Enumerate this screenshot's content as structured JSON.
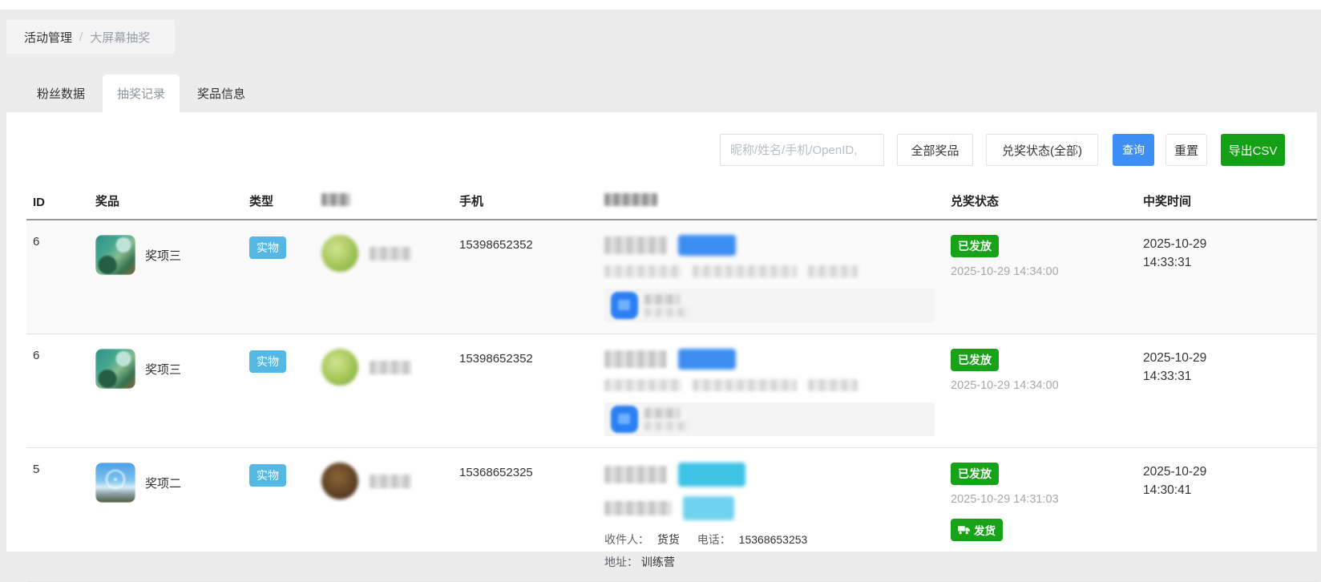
{
  "breadcrumb": {
    "parent": "活动管理",
    "separator": "/",
    "current": "大屏幕抽奖"
  },
  "tabs": [
    {
      "label": "粉丝数据",
      "active": false
    },
    {
      "label": "抽奖记录",
      "active": true
    },
    {
      "label": "奖品信息",
      "active": false
    }
  ],
  "filters": {
    "search_placeholder": "昵称/姓名/手机/OpenID,",
    "prize_select": "全部奖品",
    "status_select": "兑奖状态(全部)",
    "query_button": "查询",
    "reset_button": "重置",
    "export_button": "导出CSV"
  },
  "colors": {
    "accent_blue": "#3e8ff5",
    "accent_green": "#14a014",
    "type_badge_blue": "#55b7e3",
    "status_badge_green": "#17a317"
  },
  "table": {
    "headers": {
      "id": "ID",
      "prize": "奖品",
      "type": "类型",
      "user": "",
      "phone": "手机",
      "redeem_info": "",
      "redeem_status": "兑奖状态",
      "win_time": "中奖时间"
    },
    "rows": [
      {
        "id": "6",
        "prize_name": "奖项三",
        "type_badge": "实物",
        "phone": "15398652352",
        "status_badge": "已发放",
        "status_time": "2025-10-29 14:34:00",
        "win_time": "2025-10-29 14:33:31"
      },
      {
        "id": "6",
        "prize_name": "奖项三",
        "type_badge": "实物",
        "phone": "15398652352",
        "status_badge": "已发放",
        "status_time": "2025-10-29 14:34:00",
        "win_time": "2025-10-29 14:33:31"
      },
      {
        "id": "5",
        "prize_name": "奖项二",
        "type_badge": "实物",
        "phone": "15368652325",
        "status_badge": "已发放",
        "status_time": "2025-10-29 14:31:03",
        "ship_button": "发货",
        "receiver_label": "收件人：",
        "receiver_name": "货货",
        "phone_label": "电话：",
        "receiver_phone": "15368653253",
        "address_label": "地址：",
        "address_value": "训练营",
        "win_time": "2025-10-29 14:30:41"
      }
    ]
  }
}
